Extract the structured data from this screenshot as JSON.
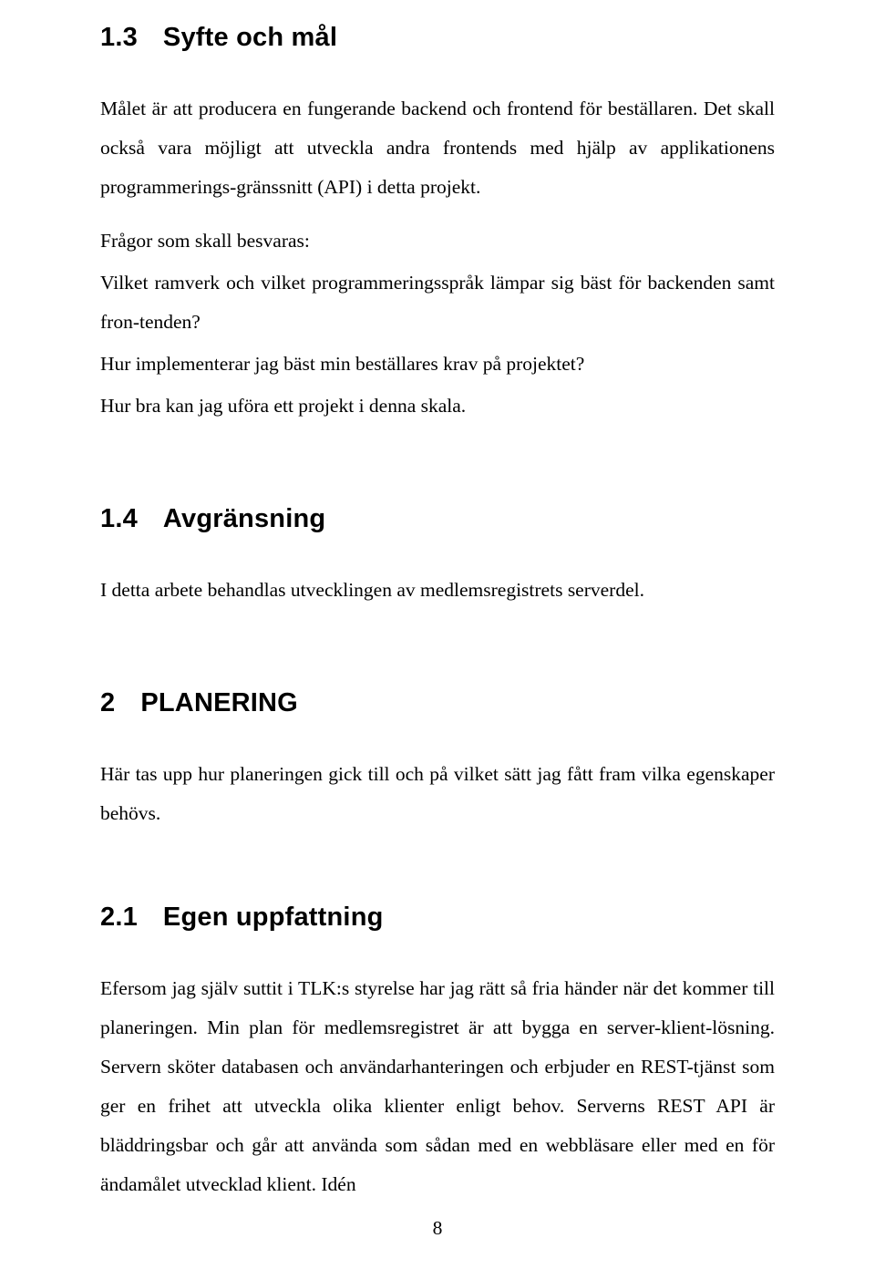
{
  "sections": {
    "s13": {
      "number": "1.3",
      "title": "Syfte och mål",
      "para1": "Målet är att producera en fungerande backend och frontend för beställaren. Det skall också vara möjligt att utveckla andra frontends med hjälp av applikationens programmerings-gränssnitt (API) i detta projekt.",
      "lead": "Frågor som skall besvaras:",
      "q1": "Vilket ramverk och vilket programmeringsspråk lämpar sig bäst för backenden samt fron-tenden?",
      "q2": "Hur implementerar jag bäst min beställares krav på projektet?",
      "q3": "Hur bra kan jag uföra ett projekt i denna skala."
    },
    "s14": {
      "number": "1.4",
      "title": "Avgränsning",
      "para": "I detta arbete behandlas utvecklingen av medlemsregistrets serverdel."
    },
    "s2": {
      "number": "2",
      "title": "PLANERING",
      "para": "Här tas upp hur planeringen gick till och på vilket sätt jag fått fram vilka egenskaper behövs."
    },
    "s21": {
      "number": "2.1",
      "title": "Egen uppfattning",
      "para": "Efersom jag själv suttit i TLK:s styrelse har jag rätt så fria händer när det kommer till planeringen. Min plan för medlemsregistret är att bygga en server-klient-lösning. Servern sköter databasen och användarhanteringen och erbjuder en REST-tjänst som ger en frihet att utveckla olika klienter enligt behov. Serverns REST API är bläddringsbar och går att använda som sådan med en webbläsare eller med en för ändamålet utvecklad klient. Idén"
    }
  },
  "page_number": "8"
}
